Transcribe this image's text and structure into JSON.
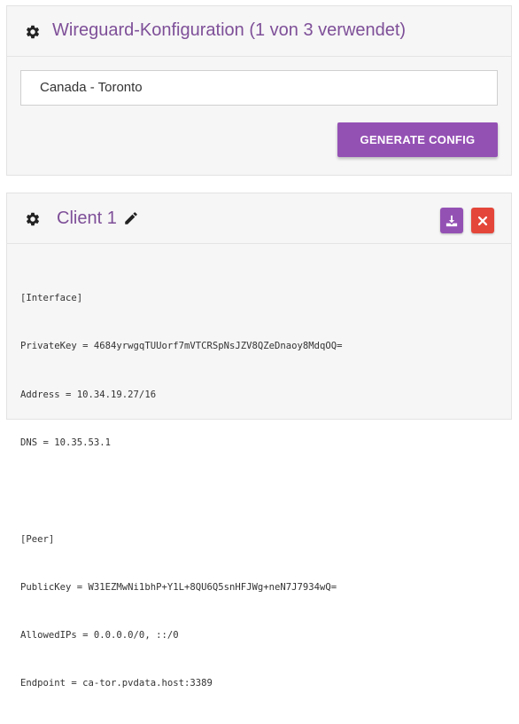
{
  "config_panel": {
    "title": "Wireguard-Konfiguration (1 von 3 verwendet)",
    "icon": "gear-icon",
    "server_value": "Canada - Toronto",
    "generate_button_label": "GENERATE CONFIG"
  },
  "client_panel": {
    "icon": "gear-icon",
    "client_name": "Client 1",
    "edit_icon": "pencil-icon",
    "download_icon": "download-icon",
    "delete_icon": "close-icon",
    "config_lines": [
      "[Interface]",
      "PrivateKey = 4684yrwgqTUUorf7mVTCRSpNsJZV8QZeDnaoy8MdqOQ=",
      "Address = 10.34.19.27/16",
      "DNS = 10.35.53.1",
      "",
      "[Peer]",
      "PublicKey = W31EZMwNi1bhP+Y1L+8QU6Q5snHFJWg+neN7J7934wQ=",
      "AllowedIPs = 0.0.0.0/0, ::/0",
      "Endpoint = ca-tor.pvdata.host:3389"
    ]
  },
  "colors": {
    "accent": "#7e4f98",
    "button": "#9451b4",
    "delete": "#e4463a",
    "panel_bg": "#f6f6f6"
  }
}
